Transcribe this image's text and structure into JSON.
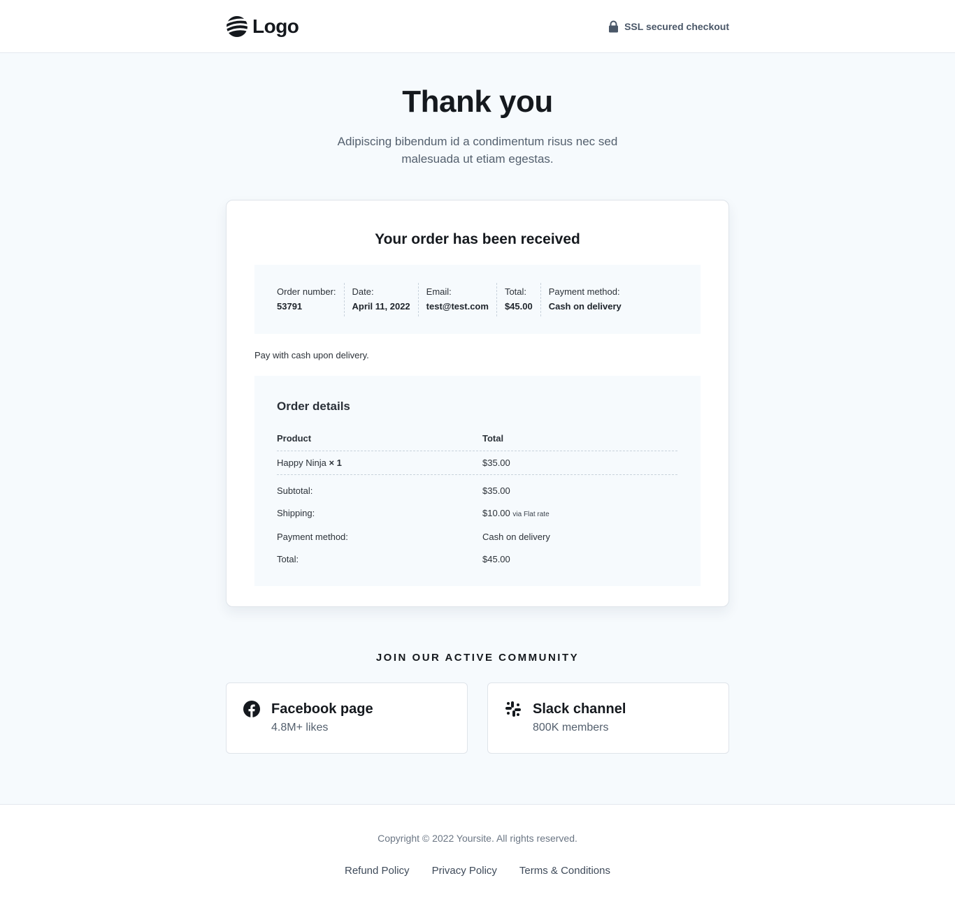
{
  "header": {
    "logo_text": "Logo",
    "ssl_text": "SSL secured checkout"
  },
  "hero": {
    "title": "Thank you",
    "subtitle": "Adipiscing bibendum id a condimentum risus nec sed malesuada ut etiam egestas."
  },
  "order": {
    "heading": "Your order has been received",
    "summary": [
      {
        "label": "Order number:",
        "value": "53791"
      },
      {
        "label": "Date:",
        "value": "April 11, 2022"
      },
      {
        "label": "Email:",
        "value": "test@test.com"
      },
      {
        "label": "Total:",
        "value": "$45.00"
      },
      {
        "label": "Payment method:",
        "value": "Cash on delivery"
      }
    ],
    "payment_note": "Pay with cash upon delivery.",
    "details": {
      "heading": "Order details",
      "col_product": "Product",
      "col_total": "Total",
      "item": {
        "name": "Happy Ninja",
        "qty": "× 1",
        "total": "$35.00"
      },
      "subtotal": {
        "label": "Subtotal:",
        "value": "$35.00"
      },
      "shipping": {
        "label": "Shipping:",
        "value": "$10.00",
        "via": "via Flat rate"
      },
      "payment_method": {
        "label": "Payment method:",
        "value": "Cash on delivery"
      },
      "total": {
        "label": "Total:",
        "value": "$45.00"
      }
    }
  },
  "community": {
    "heading": "JOIN OUR ACTIVE COMMUNITY",
    "cards": [
      {
        "title": "Facebook page",
        "subtitle": "4.8M+ likes",
        "icon": "facebook-icon"
      },
      {
        "title": "Slack channel",
        "subtitle": "800K members",
        "icon": "slack-icon"
      }
    ]
  },
  "footer": {
    "copyright": "Copyright © 2022 Yoursite. All rights reserved.",
    "links": [
      "Refund Policy",
      "Privacy Policy",
      "Terms & Conditions"
    ]
  },
  "colors": {
    "page_bg": "#f6fafd",
    "text_dark": "#15191e",
    "text_muted": "#54606e"
  }
}
